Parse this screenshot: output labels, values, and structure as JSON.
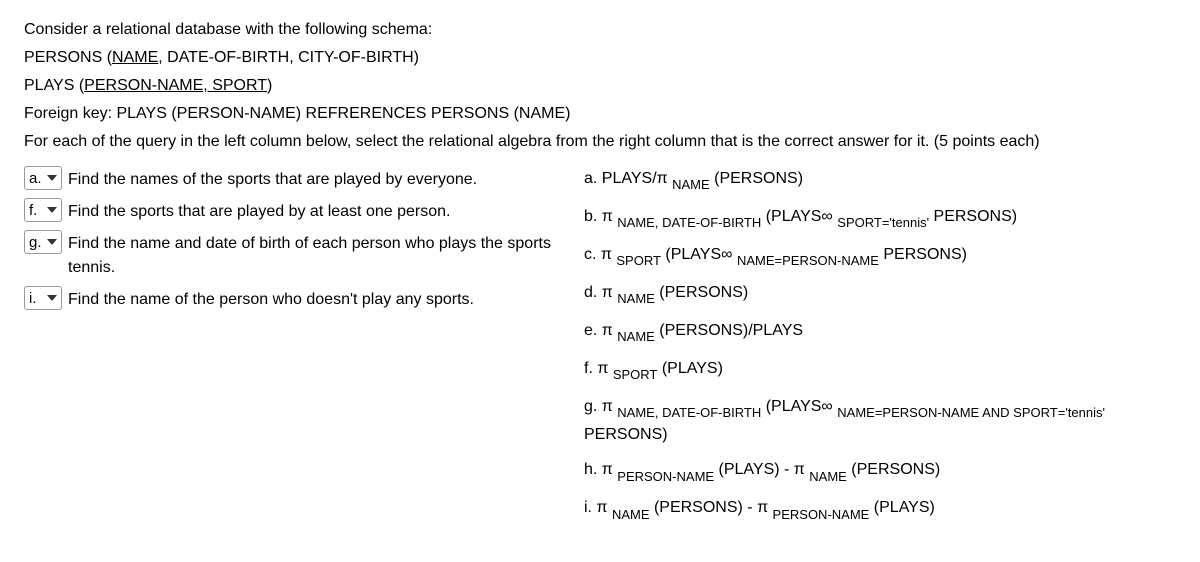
{
  "intro": {
    "line1": "Consider a relational database with the following schema:",
    "line2_prefix": "PERSONS (",
    "line2_key": "NAME",
    "line2_rest": ", DATE-OF-BIRTH, CITY-OF-BIRTH)",
    "line3_prefix": "PLAYS (",
    "line3_key": "PERSON-NAME, SPORT",
    "line3_rest": ")",
    "line4": "Foreign key: PLAYS (PERSON-NAME) REFRERENCES PERSONS (NAME)",
    "line5": "For each of the query in the left column below, select the relational algebra from the right column that is the correct answer for it. (5 points each)"
  },
  "questions": {
    "q1_sel": "a.",
    "q1_text": "Find the names of the sports that are played by everyone.",
    "q2_sel": "f.",
    "q2_text": "Find the sports that are played by at least one person.",
    "q3_sel": "g.",
    "q3_text": "Find the name and date of birth of each person who plays the sports tennis.",
    "q4_sel": "i.",
    "q4_text": "Find the name of the person who doesn't play any sports."
  },
  "options": {
    "a_label": "a. PLAYS/π ",
    "a_sub": "NAME",
    "a_rest": " (PERSONS)",
    "b_label": "b. π ",
    "b_sub": "NAME, DATE-OF-BIRTH",
    "b_mid": " (PLAYS∞ ",
    "b_sub2": "SPORT='tennis'",
    "b_rest": " PERSONS)",
    "c_label": "c. π ",
    "c_sub": "SPORT",
    "c_mid": " (PLAYS∞ ",
    "c_sub2": "NAME=PERSON-NAME",
    "c_rest": "  PERSONS)",
    "d_label": "d. π ",
    "d_sub": "NAME",
    "d_rest": " (PERSONS)",
    "e_label": "e. π ",
    "e_sub": "NAME",
    "e_rest": " (PERSONS)/PLAYS",
    "f_label": "f.  π ",
    "f_sub": "SPORT",
    "f_rest": " (PLAYS)",
    "g_label": "g. π ",
    "g_sub": "NAME, DATE-OF-BIRTH",
    "g_mid": " (PLAYS∞ ",
    "g_sub2": "NAME=PERSON-NAME AND SPORT='tennis'",
    "g_rest": " PERSONS)",
    "h_label": "h. π ",
    "h_sub": "PERSON-NAME",
    "h_mid": " (PLAYS) - π ",
    "h_sub2": "NAME",
    "h_rest": " (PERSONS)",
    "i_label": "i.  π ",
    "i_sub": "NAME",
    "i_mid": " (PERSONS) - π ",
    "i_sub2": "PERSON-NAME",
    "i_rest": " (PLAYS)"
  }
}
